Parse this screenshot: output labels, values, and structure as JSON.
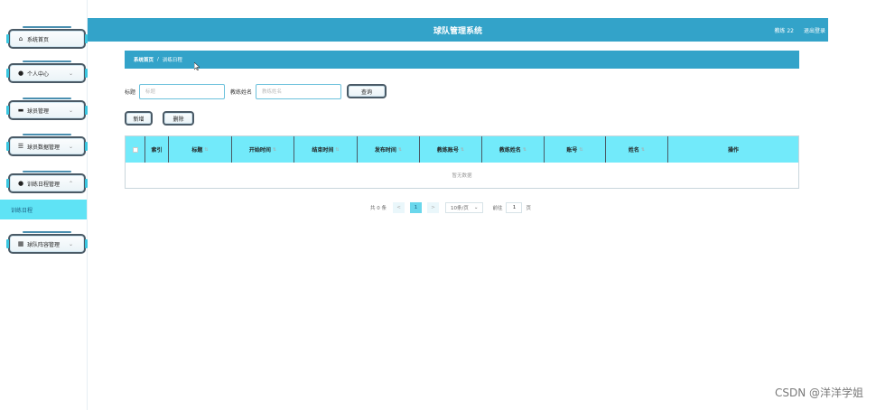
{
  "header": {
    "title": "球队管理系统",
    "user": "教练 22",
    "logout": "退出登录"
  },
  "sidebar": {
    "items": [
      {
        "label": "系统首页",
        "icon": "home-icon",
        "chevron": false
      },
      {
        "label": "个人中心",
        "icon": "user-icon",
        "chevron": true
      },
      {
        "label": "球员管理",
        "icon": "monitor-icon",
        "chevron": true
      },
      {
        "label": "球员数据管理",
        "icon": "list-icon",
        "chevron": true
      },
      {
        "label": "训练日程管理",
        "icon": "user-icon",
        "chevron": true,
        "expanded": true
      },
      {
        "label": "球队阵容管理",
        "icon": "grid-icon",
        "chevron": true
      }
    ],
    "submenu": {
      "label": "训练日程"
    }
  },
  "breadcrumb": {
    "home": "系统首页",
    "separator": "/",
    "current": "训练日程"
  },
  "search": {
    "title_label": "标题",
    "title_placeholder": "标题",
    "coach_label": "教练姓名",
    "coach_placeholder": "教练姓名",
    "query_button": "查询"
  },
  "actions": {
    "add": "新增",
    "delete": "删除"
  },
  "table": {
    "columns": [
      "索引",
      "标题",
      "开始时间",
      "结束时间",
      "发布时间",
      "教练账号",
      "教练姓名",
      "账号",
      "姓名",
      "操作"
    ],
    "empty_text": "暂无数据"
  },
  "pagination": {
    "total": "共 0 条",
    "prev": "<",
    "page": "1",
    "next": ">",
    "page_size": "10条/页",
    "goto_label": "前往",
    "goto_value": "1",
    "page_unit": "页"
  },
  "watermark": "CSDN @洋洋学姐",
  "colors": {
    "header": "#33a3c9",
    "table_head": "#72eafa",
    "submenu": "#5fe3f5"
  }
}
